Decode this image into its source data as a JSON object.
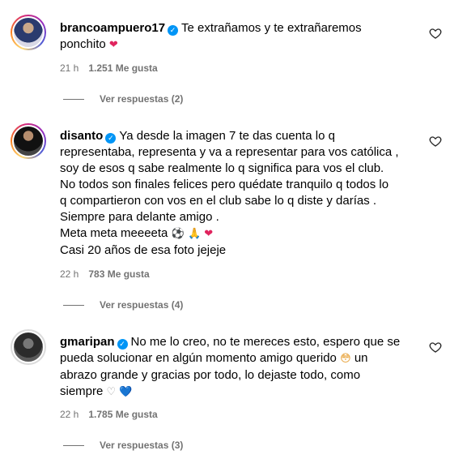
{
  "comments": [
    {
      "username": "brancoampuero17",
      "text_lines": [
        "Te extrañamos y te extrañaremos",
        "ponchito"
      ],
      "emojis": [
        "❤"
      ],
      "time": "21 h",
      "likes": "1.251 Me gusta",
      "replies": "Ver respuestas (2)"
    },
    {
      "username": "disanto",
      "text_lines": [
        "Ya desde la imagen 7 te das cuenta lo q",
        "representaba, representa y va a representar para vos católica ,",
        "soy de esos q sabe realmente lo q significa para vos el club.",
        "No todos son finales felices pero quédate tranquilo q todos lo",
        "q compartieron con vos en el club sabe lo q diste y darías .",
        "Siempre para delante amigo .",
        "Meta meta meeeeta",
        "Casi 20 años de esa foto jejeje"
      ],
      "emojis": [
        "⚽",
        "🙏",
        "❤"
      ],
      "time": "22 h",
      "likes": "783 Me gusta",
      "replies": "Ver respuestas (4)"
    },
    {
      "username": "gmaripan",
      "text_lines": [
        "No me lo creo, no te mereces esto, espero que se",
        "pueda solucionar en algún momento amigo querido",
        "un",
        "abrazo grande y gracias por todo, lo dejaste todo, como",
        "siempre"
      ],
      "emojis": [
        "😳",
        "♡",
        "💙"
      ],
      "time": "22 h",
      "likes": "1.785 Me gusta",
      "replies": "Ver respuestas (3)"
    }
  ],
  "icons": {
    "verified": "verified-badge-icon",
    "like": "heart-outline-icon"
  },
  "colors": {
    "verified": "#0095f6",
    "muted": "#737373",
    "heart": "#e0245e"
  }
}
